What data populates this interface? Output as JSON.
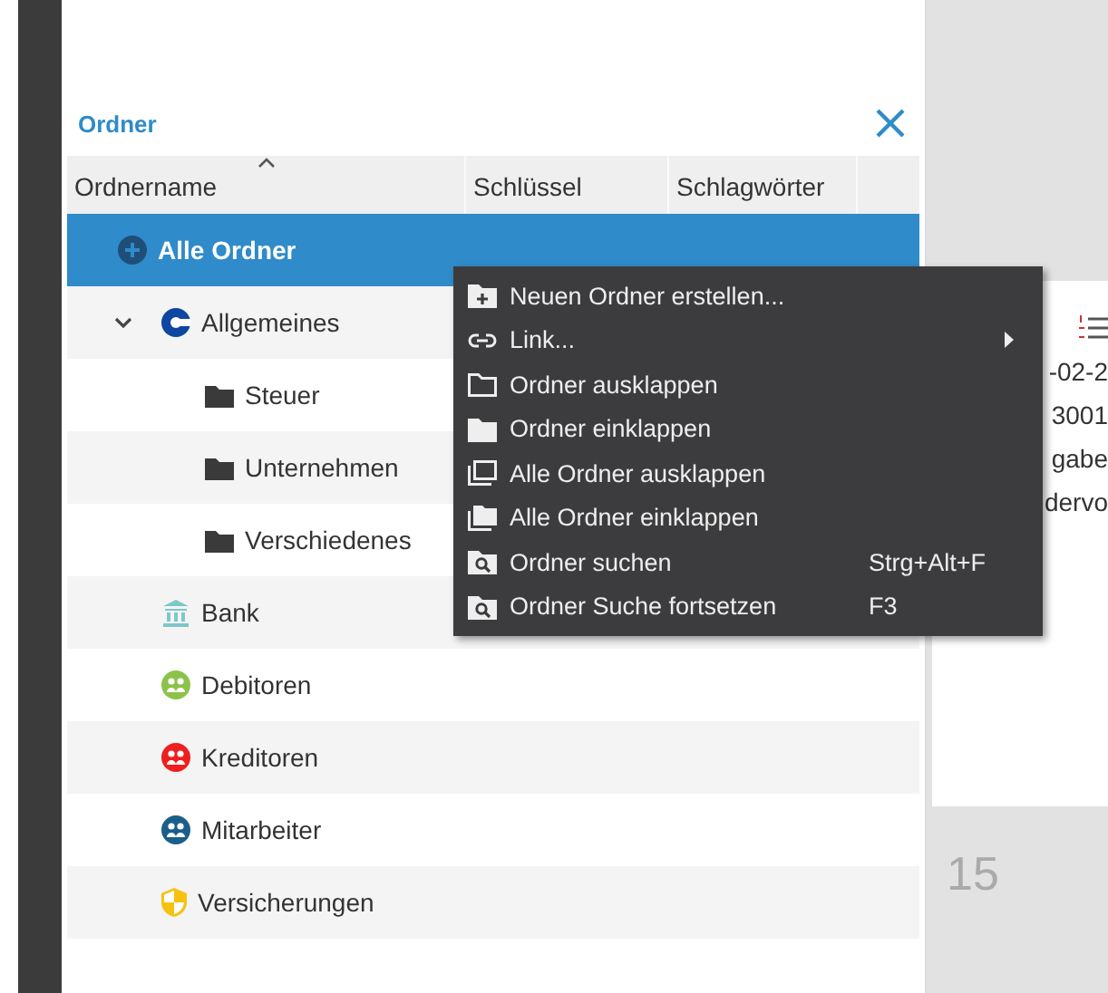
{
  "dialog": {
    "title": "Ordner"
  },
  "columns": [
    {
      "label": "Ordnername",
      "sorted": true
    },
    {
      "label": "Schlüssel",
      "sorted": false
    },
    {
      "label": "Schlagwörter",
      "sorted": false
    }
  ],
  "tree": [
    {
      "label": "Alle Ordner",
      "kind": "all",
      "selected": true,
      "color": "#1f4e79"
    },
    {
      "label": "Allgemeines",
      "kind": "client",
      "selected": false,
      "expanded": true,
      "color": "#0d47a1",
      "children": [
        {
          "label": "Steuer",
          "kind": "folder",
          "selected": false
        },
        {
          "label": "Unternehmen",
          "kind": "folder",
          "selected": false
        },
        {
          "label": "Verschiedenes",
          "kind": "folder",
          "selected": false
        }
      ]
    },
    {
      "label": "Bank",
      "kind": "bank",
      "selected": false,
      "color": "#7ec8c8"
    },
    {
      "label": "Debitoren",
      "kind": "people",
      "selected": false,
      "color": "#8bc34a"
    },
    {
      "label": "Kreditoren",
      "kind": "people",
      "selected": false,
      "color": "#f01e1e"
    },
    {
      "label": "Mitarbeiter",
      "kind": "people",
      "selected": false,
      "color": "#1b5e8a"
    },
    {
      "label": "Versicherungen",
      "kind": "shield",
      "selected": false,
      "color": "#f6c20f"
    }
  ],
  "context_menu": [
    {
      "label": "Neuen Ordner erstellen...",
      "kind": "new-folder"
    },
    {
      "label": "Link...",
      "kind": "link",
      "submenu": true
    },
    {
      "label": "Ordner ausklappen",
      "kind": "folder-outline"
    },
    {
      "label": "Ordner einklappen",
      "kind": "folder-solid"
    },
    {
      "label": "Alle Ordner ausklappen",
      "kind": "folders-outline"
    },
    {
      "label": "Alle Ordner einklappen",
      "kind": "folders-solid"
    },
    {
      "label": "Ordner suchen",
      "kind": "search",
      "shortcut": "Strg+Alt+F"
    },
    {
      "label": "Ordner Suche fortsetzen",
      "kind": "search-next",
      "shortcut": "F3"
    }
  ],
  "background_card": {
    "lines": [
      "-02-2",
      "3001",
      "gabe",
      "dervo"
    ]
  },
  "background_number": "15"
}
